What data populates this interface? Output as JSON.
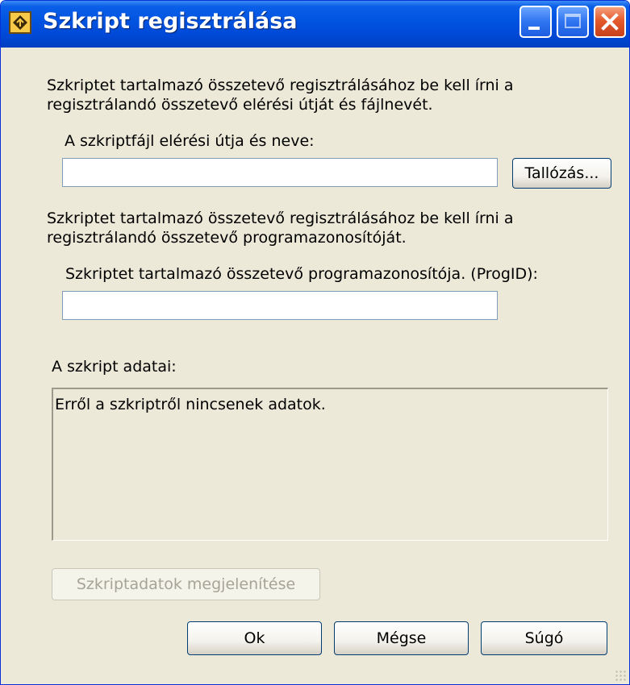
{
  "window": {
    "title": "Szkript regisztrálása",
    "icon": "script-register-icon"
  },
  "titlebar_buttons": [
    "minimize",
    "maximize",
    "close"
  ],
  "path_section": {
    "instruction_line1": "Szkriptet tartalmazó összetevő regisztrálásához be kell írni a",
    "instruction_line2": "regisztrálandó összetevő elérési útját és fájlnevét.",
    "label": "A szkriptfájl elérési útja és neve:",
    "value": "",
    "browse_button": "Tallózás..."
  },
  "progid_section": {
    "instruction_line1": "Szkriptet tartalmazó összetevő regisztrálásához be kell írni a",
    "instruction_line2": "regisztrálandó összetevő programazonosítóját.",
    "label": "Szkriptet tartalmazó összetevő programazonosítója. (ProgID):",
    "value": ""
  },
  "script_info": {
    "label": "A szkript adatai:",
    "text": "Erről a szkriptről nincsenek adatok."
  },
  "buttons": {
    "show_data": "Szkriptadatok megjelenítése",
    "ok": "Ok",
    "cancel": "Mégse",
    "help": "Súgó"
  },
  "colors": {
    "titlebar": "#0054e3",
    "dialog_bg": "#ece9d8",
    "close_button": "#e45a2c"
  }
}
